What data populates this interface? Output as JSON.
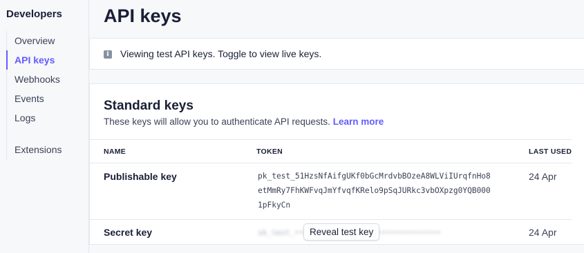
{
  "sidebar": {
    "title": "Developers",
    "items": [
      {
        "label": "Overview"
      },
      {
        "label": "API keys",
        "active": true
      },
      {
        "label": "Webhooks"
      },
      {
        "label": "Events"
      },
      {
        "label": "Logs"
      },
      {
        "label": "Extensions"
      }
    ]
  },
  "main": {
    "title": "API keys",
    "banner": {
      "icon": "info-icon",
      "text": "Viewing test API keys. Toggle to view live keys."
    },
    "standard_keys": {
      "title": "Standard keys",
      "description": "These keys will allow you to authenticate API requests.",
      "learn_more": "Learn more",
      "columns": [
        "NAME",
        "TOKEN",
        "LAST USED"
      ],
      "rows": [
        {
          "name": "Publishable key",
          "token": "pk_test_51HzsNfAifgUKf0bGcMrdvbBOzeA8WLViIUrqfnHo8etMmRy7FhKWFvqJmYfvqfKRelo9pSqJURkc3vbOXpzg0YQB0001pFkyCn",
          "last_used": "24 Apr"
        },
        {
          "name": "Secret key",
          "reveal_label": "Reveal test key",
          "last_used": "24 Apr"
        }
      ]
    }
  },
  "colors": {
    "accent": "#635bff",
    "text": "#1a1f36",
    "border": "#e3e8ee"
  }
}
